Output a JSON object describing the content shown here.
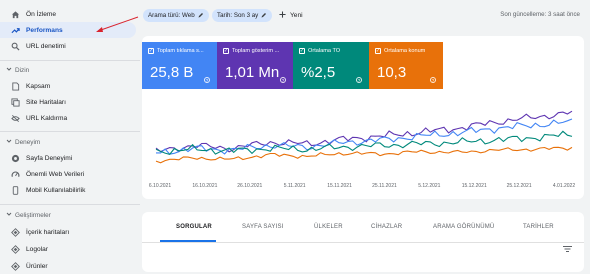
{
  "sidebar": {
    "items": [
      {
        "label": "Ön İzleme",
        "icon": "home-icon"
      },
      {
        "label": "Performans",
        "icon": "trending-up-icon"
      },
      {
        "label": "URL denetimi",
        "icon": "search-icon"
      }
    ],
    "sections": [
      {
        "title": "Dizin",
        "items": [
          {
            "label": "Kapsam",
            "icon": "file-icon"
          },
          {
            "label": "Site Haritaları",
            "icon": "sitemap-icon"
          },
          {
            "label": "URL Kaldırma",
            "icon": "eye-off-icon"
          }
        ]
      },
      {
        "title": "Deneyim",
        "items": [
          {
            "label": "Sayfa Deneyimi",
            "icon": "star-circle-icon"
          },
          {
            "label": "Önemli Web Verileri",
            "icon": "speed-icon"
          },
          {
            "label": "Mobil Kullanılabilirlik",
            "icon": "phone-icon"
          }
        ]
      },
      {
        "title": "Geliştirmeler",
        "items": [
          {
            "label": "İçerik haritaları",
            "icon": "diamond-icon"
          },
          {
            "label": "Logolar",
            "icon": "diamond-icon"
          },
          {
            "label": "Ürünler",
            "icon": "diamond-icon"
          }
        ]
      }
    ]
  },
  "filters": {
    "search_type": "Arama türü: Web",
    "date": "Tarih: Son 3 ay",
    "new_label": "Yeni"
  },
  "last_update": "Son güncelleme: 3 saat önce",
  "metrics": [
    {
      "label": "Toplam tıklama s...",
      "value": "25,8 B",
      "color": "#4285f4"
    },
    {
      "label": "Toplam gösterim ...",
      "value": "1,01 Mn",
      "color": "#5e35b1"
    },
    {
      "label": "Ortalama TO",
      "value": "%2,5",
      "color": "#00897b"
    },
    {
      "label": "Ortalama konum",
      "value": "10,3",
      "color": "#e8710a"
    }
  ],
  "tabs": [
    "SORGULAR",
    "SAYFA SAYISI",
    "ÜLKELER",
    "CİHAZLAR",
    "ARAMA GÖRÜNÜMÜ",
    "TARİHLER"
  ],
  "chart_data": {
    "type": "line",
    "x": [
      "6.10.2021",
      "16.10.2021",
      "26.10.2021",
      "5.11.2021",
      "15.11.2021",
      "25.11.2021",
      "5.12.2021",
      "15.12.2021",
      "25.12.2021",
      "4.01.2022"
    ],
    "series": [
      {
        "color": "#5e35b1",
        "values": [
          0.3,
          0.38,
          0.34,
          0.42,
          0.4,
          0.46,
          0.5,
          0.55,
          0.6,
          0.68,
          0.74,
          0.8
        ]
      },
      {
        "color": "#4285f4",
        "values": [
          0.28,
          0.34,
          0.32,
          0.38,
          0.36,
          0.42,
          0.45,
          0.5,
          0.54,
          0.6,
          0.64,
          0.68
        ]
      },
      {
        "color": "#00897b",
        "values": [
          0.3,
          0.33,
          0.31,
          0.34,
          0.33,
          0.36,
          0.38,
          0.4,
          0.42,
          0.45,
          0.48,
          0.52
        ]
      },
      {
        "color": "#e8710a",
        "values": [
          0.18,
          0.22,
          0.2,
          0.26,
          0.24,
          0.28,
          0.27,
          0.3,
          0.29,
          0.32,
          0.33,
          0.35
        ]
      }
    ],
    "grid": false,
    "legend": "none"
  }
}
